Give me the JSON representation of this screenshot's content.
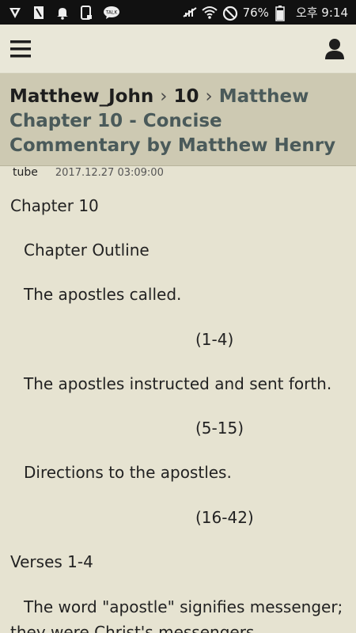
{
  "status_bar": {
    "battery": "76%",
    "time": "오후 9:14",
    "icons": [
      "shield-icon",
      "document-icon",
      "bell-icon",
      "phone-icon",
      "talk-icon",
      "mute-icon",
      "wifi-icon",
      "block-icon",
      "battery-icon"
    ]
  },
  "app_bar": {
    "menu_icon": "hamburger-icon",
    "user_icon": "user-icon"
  },
  "header": {
    "crumb1": "Matthew_John",
    "sep1": "›",
    "crumb2": "10",
    "sep2": "›",
    "title": "Matthew Chapter 10 - Concise Commentary by Matthew Henry",
    "tag": "tube",
    "date": "2017.12.27 03:09:00"
  },
  "content": {
    "lines": [
      "Chapter 10",
      "Chapter Outline",
      "The apostles called.",
      "(1-4)",
      "The apostles instructed and sent forth.",
      "(5-15)",
      "Directions to the apostles.",
      "(16-42)",
      "Verses 1-4",
      "The word \"apostle\" signifies messenger;",
      "they were Christ's messengers"
    ]
  },
  "colors": {
    "background": "#e6e3d1",
    "header_bg": "#cdc9b2",
    "title_link": "#4a5a5a",
    "statusbar": "#111111"
  }
}
